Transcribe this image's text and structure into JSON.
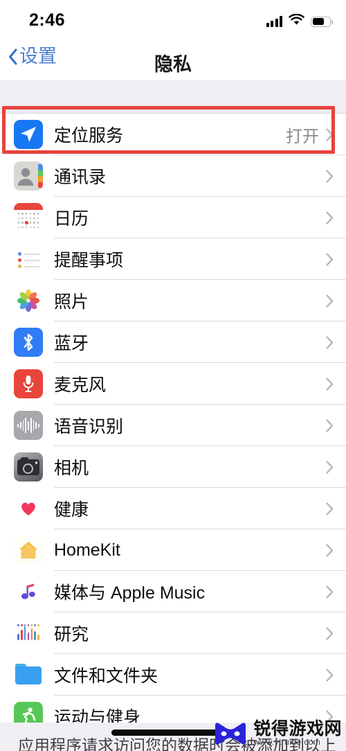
{
  "status_bar": {
    "time": "2:46",
    "signal_icon": "cellular-signal-icon",
    "wifi_icon": "wifi-icon",
    "battery_icon": "battery-icon",
    "battery_level": 60
  },
  "nav_bar": {
    "back_label": "设置",
    "back_icon": "chevron-left-icon",
    "title": "隐私"
  },
  "colors": {
    "accent_blue": "#4a7fd4",
    "highlight_red": "#e8423d",
    "value_gray": "#8a8a8e",
    "group_bg": "#f0eff4"
  },
  "highlight": {
    "target_row": "定位服务",
    "color": "#e8423d"
  },
  "list": {
    "rows": [
      {
        "label": "定位服务",
        "value": "打开",
        "icon": "location-services-icon",
        "highlighted": true
      },
      {
        "label": "通讯录",
        "value": "",
        "icon": "contacts-icon",
        "highlighted": false
      },
      {
        "label": "日历",
        "value": "",
        "icon": "calendar-icon",
        "highlighted": false
      },
      {
        "label": "提醒事项",
        "value": "",
        "icon": "reminders-icon",
        "highlighted": false
      },
      {
        "label": "照片",
        "value": "",
        "icon": "photos-icon",
        "highlighted": false
      },
      {
        "label": "蓝牙",
        "value": "",
        "icon": "bluetooth-icon",
        "highlighted": false
      },
      {
        "label": "麦克风",
        "value": "",
        "icon": "microphone-icon",
        "highlighted": false
      },
      {
        "label": "语音识别",
        "value": "",
        "icon": "speech-recognition-icon",
        "highlighted": false
      },
      {
        "label": "相机",
        "value": "",
        "icon": "camera-icon",
        "highlighted": false
      },
      {
        "label": "健康",
        "value": "",
        "icon": "health-icon",
        "highlighted": false
      },
      {
        "label": "HomeKit",
        "value": "",
        "icon": "homekit-icon",
        "highlighted": false
      },
      {
        "label": "媒体与 Apple Music",
        "value": "",
        "icon": "apple-music-icon",
        "highlighted": false
      },
      {
        "label": "研究",
        "value": "",
        "icon": "research-icon",
        "highlighted": false
      },
      {
        "label": "文件和文件夹",
        "value": "",
        "icon": "files-icon",
        "highlighted": false
      },
      {
        "label": "运动与健身",
        "value": "",
        "icon": "fitness-icon",
        "highlighted": false
      }
    ]
  },
  "footer": {
    "note": "应用程序请求访问您的数据时会被添加到以上"
  },
  "watermark": {
    "name": "锐得游戏网",
    "url": "www.ytruide.com"
  }
}
